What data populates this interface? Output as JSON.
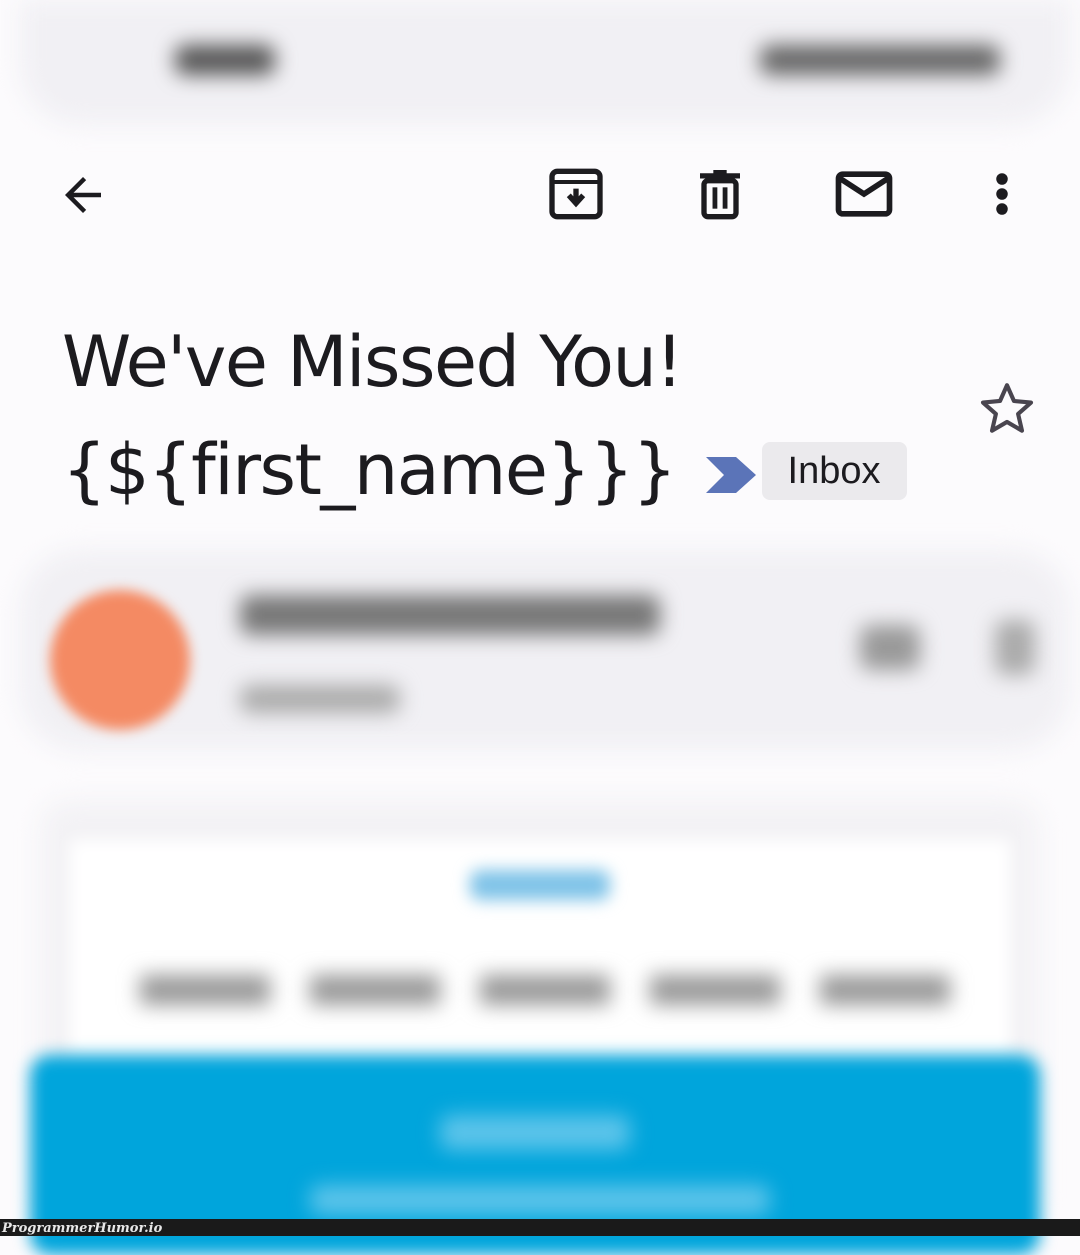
{
  "toolbar": {
    "back_icon": "arrow-left-icon",
    "actions": [
      "archive-icon",
      "delete-icon",
      "mark-unread-icon",
      "more-vert-icon"
    ]
  },
  "email": {
    "subject": "We've Missed You! {${first_name}}}",
    "label": "Inbox",
    "label_chevron_color": "#5b74b8",
    "starred": false
  },
  "colors": {
    "avatar": "#f48a63",
    "banner": "#00a5dc"
  },
  "watermark": "ProgrammerHumor.io"
}
